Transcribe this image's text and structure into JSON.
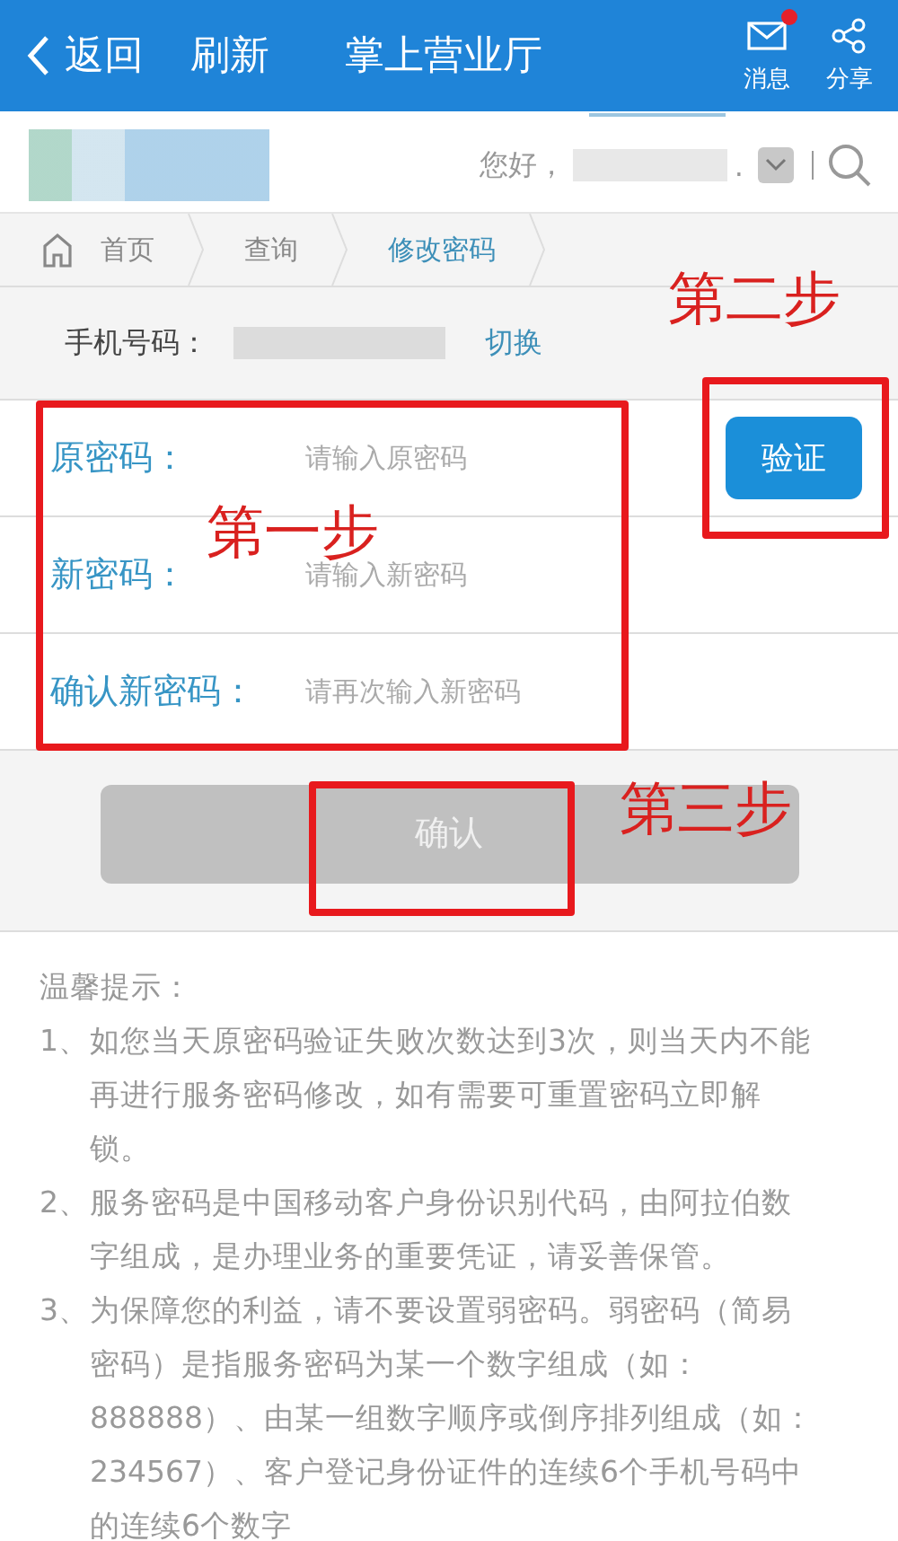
{
  "header": {
    "back": "返回",
    "refresh": "刷新",
    "title": "掌上营业厅",
    "actions": [
      {
        "kind": "mail",
        "label": "消息",
        "badge": true
      },
      {
        "kind": "share",
        "label": "分享",
        "badge": false
      }
    ]
  },
  "account": {
    "greeting": "您好，",
    "suffix": "."
  },
  "breadcrumb": [
    {
      "kind": "home",
      "label": "首页",
      "selected": false
    },
    {
      "kind": "link",
      "label": "查询",
      "selected": false
    },
    {
      "kind": "link",
      "label": "修改密码",
      "selected": true
    }
  ],
  "phone": {
    "label": "手机号码：",
    "switch": "切换"
  },
  "fields": [
    {
      "label": "原密码：",
      "placeholder": "请输入原密码"
    },
    {
      "label": "新密码：",
      "placeholder": "请输入新密码"
    },
    {
      "label": "确认新密码：",
      "placeholder": "请再次输入新密码"
    }
  ],
  "verify_button": "验证",
  "submit_button": {
    "label": "确认",
    "disabled": true
  },
  "tips": {
    "title": "温馨提示：",
    "items": [
      {
        "number": "1、",
        "text": "如您当天原密码验证失败次数达到3次，则当天内不能再进行服务密码修改，如有需要可重置密码立即解锁。"
      },
      {
        "number": "2、",
        "text": "服务密码是中国移动客户身份识别代码，由阿拉伯数字组成，是办理业务的重要凭证，请妥善保管。"
      },
      {
        "number": "3、",
        "text": "为保障您的利益，请不要设置弱密码。弱密码（简易密码）是指服务密码为某一个数字组成（如：888888）、由某一组数字顺序或倒序排列组成（如：234567）、客户登记身份证件的连续6个手机号码中的连续6个数字"
      }
    ]
  },
  "annotations": [
    {
      "kind": "step2",
      "text": "第二步"
    },
    {
      "kind": "step1",
      "text": "第一步"
    },
    {
      "kind": "step3",
      "text": "第三步"
    }
  ]
}
